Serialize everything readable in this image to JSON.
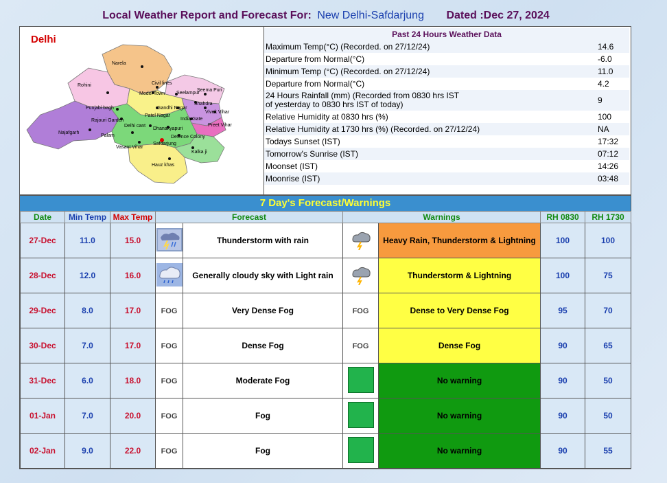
{
  "header": {
    "title": "Local Weather Report and Forecast For:",
    "station": "New Delhi-Safdarjung",
    "dated": "Dated :Dec 27, 2024"
  },
  "map": {
    "title": "Delhi",
    "labels": [
      "Narela",
      "Rohini",
      "Civil lines",
      "Model Town",
      "Seelampur",
      "Seema Puri",
      "Shahdra",
      "Vivek Vihar",
      "Punjabi bagh",
      "Patel Nagar",
      "Gandhi Nagar",
      "Preet Vihar",
      "Rajouri Garden",
      "India Gate",
      "Najafgarh",
      "Delhi cant",
      "Dhanakyapuri",
      "Defence Colony",
      "Palam",
      "Vasant Vihar",
      "Safdarjung",
      "Kalka ji",
      "Hauz khas"
    ]
  },
  "past24": {
    "title": "Past 24 Hours Weather Data",
    "rows": [
      {
        "label": "Maximum Temp(°C) (Recorded. on 27/12/24)",
        "value": "14.6"
      },
      {
        "label": "Departure from Normal(°C)",
        "value": "-6.0"
      },
      {
        "label": "Minimum Temp (°C) (Recorded. on 27/12/24)",
        "value": "11.0"
      },
      {
        "label": "Departure from Normal(°C)",
        "value": "4.2"
      },
      {
        "label": "24 Hours Rainfall (mm) (Recorded from 0830 hrs IST",
        "label2": "of yesterday to 0830 hrs IST of today)",
        "value": "9"
      },
      {
        "label": "Relative Humidity at 0830 hrs (%)",
        "value": "100"
      },
      {
        "label": "Relative Humidity at 1730 hrs (%) (Recorded. on 27/12/24)",
        "value": "NA"
      },
      {
        "label": "Todays Sunset (IST)",
        "value": "17:32"
      },
      {
        "label": "Tomorrow's Sunrise (IST)",
        "value": "07:12"
      },
      {
        "label": "Moonset (IST)",
        "value": "14:26"
      },
      {
        "label": "Moonrise (IST)",
        "value": "03:48"
      }
    ]
  },
  "forecast": {
    "title": "7 Day's Forecast/Warnings",
    "headers": {
      "date": "Date",
      "min": "Min Temp",
      "max": "Max Temp",
      "forecast": "Forecast",
      "warnings": "Warnings",
      "rh0830": "RH 0830",
      "rh1730": "RH 1730"
    },
    "colors": {
      "orange": "#f79a3e",
      "yellow": "#ffff44",
      "green": "#109a10"
    },
    "rows": [
      {
        "date": "27-Dec",
        "min": "11.0",
        "max": "15.0",
        "icon": "thunderstorm-rain-icon",
        "fog": "",
        "text": "Thunderstorm with rain",
        "warn_icon": "thunder-cloud-icon",
        "warn_fog": "",
        "warning": "Heavy Rain, Thunderstorm & Lightning",
        "warn_color": "orange",
        "rh0830": "100",
        "rh1730": "100"
      },
      {
        "date": "28-Dec",
        "min": "12.0",
        "max": "16.0",
        "icon": "cloudy-light-rain-icon",
        "fog": "",
        "text": "Generally cloudy sky with Light rain",
        "warn_icon": "thunder-cloud-icon",
        "warn_fog": "",
        "warning": "Thunderstorm & Lightning",
        "warn_color": "yellow",
        "rh0830": "100",
        "rh1730": "75"
      },
      {
        "date": "29-Dec",
        "min": "8.0",
        "max": "17.0",
        "icon": "fog-icon",
        "fog": "FOG",
        "text": "Very Dense Fog",
        "warn_icon": "fog-icon",
        "warn_fog": "FOG",
        "warning": "Dense to Very Dense Fog",
        "warn_color": "yellow",
        "rh0830": "95",
        "rh1730": "70"
      },
      {
        "date": "30-Dec",
        "min": "7.0",
        "max": "17.0",
        "icon": "fog-icon",
        "fog": "FOG",
        "text": "Dense Fog",
        "warn_icon": "fog-icon",
        "warn_fog": "FOG",
        "warning": "Dense Fog",
        "warn_color": "yellow",
        "rh0830": "90",
        "rh1730": "65"
      },
      {
        "date": "31-Dec",
        "min": "6.0",
        "max": "18.0",
        "icon": "fog-icon",
        "fog": "FOG",
        "text": "Moderate Fog",
        "warn_icon": "green-square-icon",
        "warn_fog": "",
        "warning": "No warning",
        "warn_color": "green",
        "rh0830": "90",
        "rh1730": "50"
      },
      {
        "date": "01-Jan",
        "min": "7.0",
        "max": "20.0",
        "icon": "fog-icon",
        "fog": "FOG",
        "text": "Fog",
        "warn_icon": "green-square-icon",
        "warn_fog": "",
        "warning": "No warning",
        "warn_color": "green",
        "rh0830": "90",
        "rh1730": "50"
      },
      {
        "date": "02-Jan",
        "min": "9.0",
        "max": "22.0",
        "icon": "fog-icon",
        "fog": "FOG",
        "text": "Fog",
        "warn_icon": "green-square-icon",
        "warn_fog": "",
        "warning": "No warning",
        "warn_color": "green",
        "rh0830": "90",
        "rh1730": "55"
      }
    ]
  }
}
